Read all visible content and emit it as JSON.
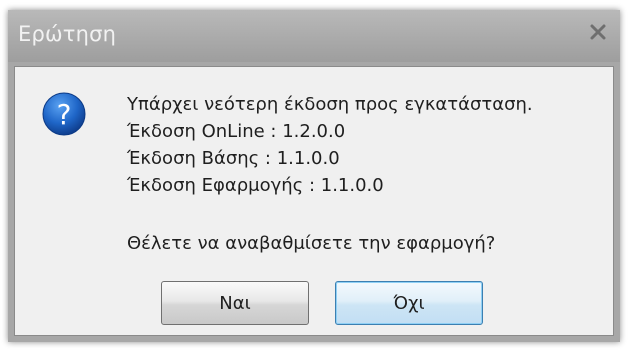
{
  "dialog": {
    "title": "Ερώτηση",
    "close_glyph": "x",
    "icon": "question-icon",
    "message_lines": [
      "Υπάρχει νεότερη έκδοση προς εγκατάσταση.",
      "Έκδοση OnLine : 1.2.0.0",
      "Έκδοση Βάσης : 1.1.0.0",
      "Έκδοση Εφαρμογής : 1.1.0.0"
    ],
    "question": "Θέλετε να αναβαθμίσετε την εφαρμογή?",
    "buttons": {
      "yes_label": "Ναι",
      "no_label": "Όχι"
    }
  },
  "colors": {
    "titlebar": "#a7a7a7",
    "icon_blue": "#1f66c8",
    "default_button_border": "#3c7fb1"
  }
}
